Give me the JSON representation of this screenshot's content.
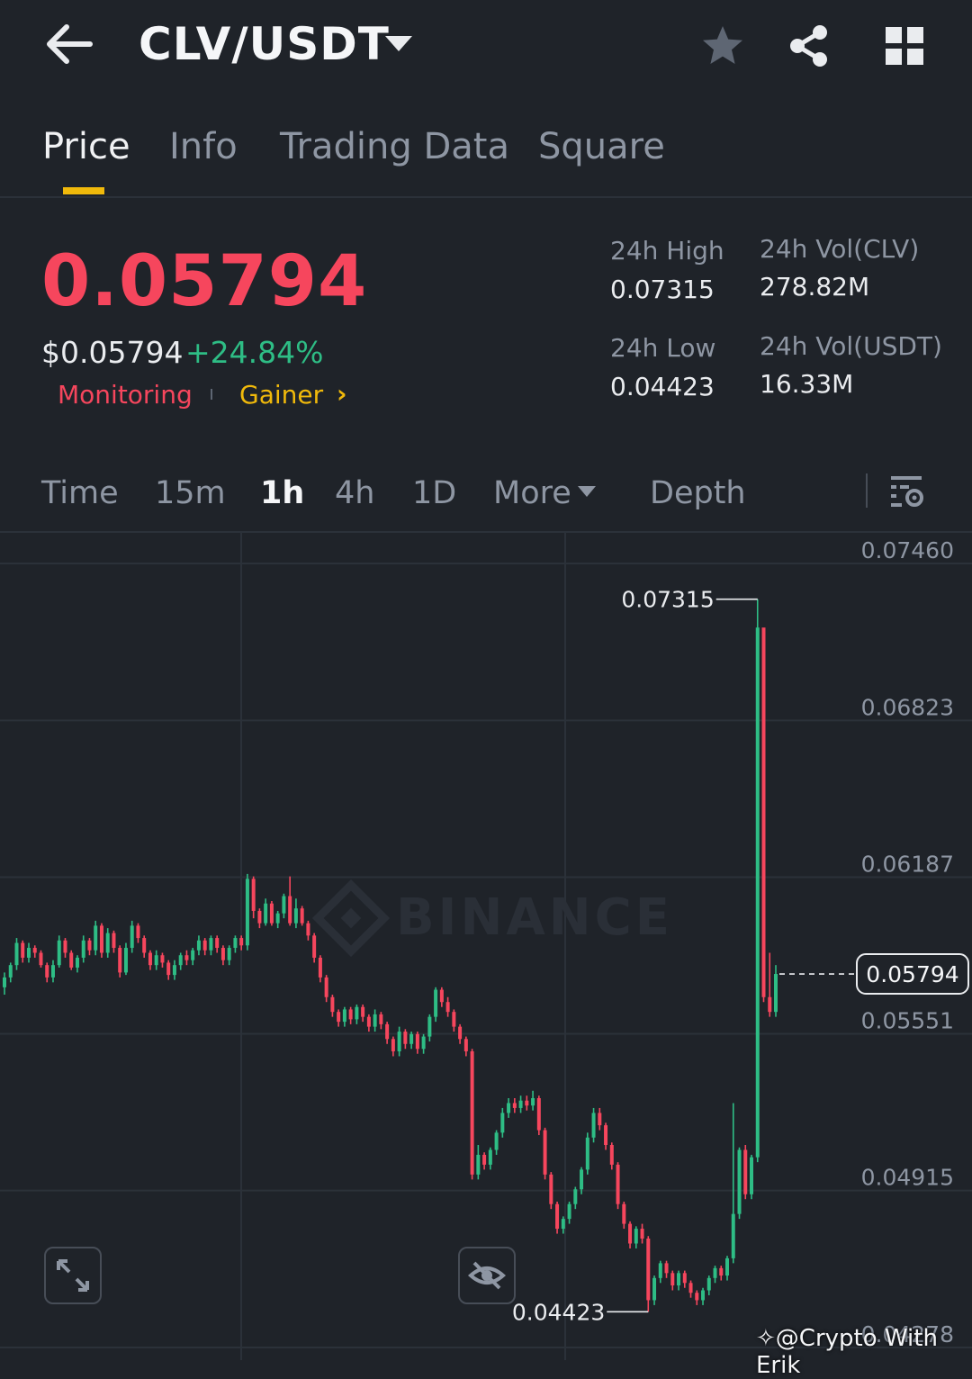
{
  "header": {
    "pair": "CLV/USDT",
    "icons": [
      "back-arrow-icon",
      "caret-down-icon",
      "star-icon",
      "share-icon",
      "grid-icon"
    ]
  },
  "tabs": [
    {
      "label": "Price",
      "active": true
    },
    {
      "label": "Info",
      "active": false
    },
    {
      "label": "Trading Data",
      "active": false
    },
    {
      "label": "Square",
      "active": false
    }
  ],
  "ticker": {
    "last_price": "0.05794",
    "fiat_price": "$0.05794",
    "change": "+24.84%",
    "tag_monitoring": "Monitoring",
    "tag_gainer": "Gainer",
    "tag_chevron": "›",
    "high_label": "24h High",
    "high_value": "0.07315",
    "low_label": "24h Low",
    "low_value": "0.04423",
    "vol_base_label": "24h Vol(CLV)",
    "vol_base_value": "278.82M",
    "vol_quote_label": "24h Vol(USDT)",
    "vol_quote_value": "16.33M"
  },
  "intervals": {
    "items": [
      {
        "label": "Time",
        "active": false
      },
      {
        "label": "15m",
        "active": false
      },
      {
        "label": "1h",
        "active": true
      },
      {
        "label": "4h",
        "active": false
      },
      {
        "label": "1D",
        "active": false
      },
      {
        "label": "More",
        "active": false
      },
      {
        "label": "Depth",
        "active": false
      }
    ]
  },
  "colors": {
    "up": "#2ebd85",
    "down": "#f6465d",
    "accent": "#f0b90b",
    "bg": "#1f2329"
  },
  "chart_data": {
    "type": "candlestick",
    "y_ticks": [
      "0.07460",
      "0.06823",
      "0.06187",
      "0.05551",
      "0.04915",
      "0.04278"
    ],
    "ylim": [
      0.04278,
      0.0746
    ],
    "high_marker": "0.07315",
    "low_marker": "0.04423",
    "last_price_label": "0.05794",
    "last_price": 0.05794,
    "watermark": "BINANCE",
    "candles": [
      [
        0.0574,
        0.0578,
        0.0571,
        0.058
      ],
      [
        0.0578,
        0.0583,
        0.0576,
        0.0584
      ],
      [
        0.0583,
        0.0592,
        0.0581,
        0.0594
      ],
      [
        0.0592,
        0.0586,
        0.0584,
        0.0593
      ],
      [
        0.0586,
        0.059,
        0.0584,
        0.0592
      ],
      [
        0.059,
        0.0588,
        0.0586,
        0.0591
      ],
      [
        0.0588,
        0.0583,
        0.0582,
        0.0589
      ],
      [
        0.0583,
        0.0578,
        0.0576,
        0.0584
      ],
      [
        0.0578,
        0.0583,
        0.0576,
        0.0585
      ],
      [
        0.0583,
        0.0593,
        0.0582,
        0.0595
      ],
      [
        0.0593,
        0.0588,
        0.0586,
        0.0594
      ],
      [
        0.0588,
        0.0582,
        0.0581,
        0.0589
      ],
      [
        0.0582,
        0.0586,
        0.058,
        0.0587
      ],
      [
        0.0586,
        0.0593,
        0.0584,
        0.0595
      ],
      [
        0.0593,
        0.0589,
        0.0587,
        0.0594
      ],
      [
        0.0589,
        0.0599,
        0.0587,
        0.0601
      ],
      [
        0.0599,
        0.0588,
        0.0586,
        0.06
      ],
      [
        0.0588,
        0.0596,
        0.0586,
        0.0598
      ],
      [
        0.0596,
        0.059,
        0.0588,
        0.0597
      ],
      [
        0.059,
        0.058,
        0.0578,
        0.0591
      ],
      [
        0.058,
        0.059,
        0.0579,
        0.0592
      ],
      [
        0.059,
        0.0599,
        0.0588,
        0.0601
      ],
      [
        0.0599,
        0.0594,
        0.0592,
        0.06
      ],
      [
        0.0594,
        0.0588,
        0.0586,
        0.0595
      ],
      [
        0.0588,
        0.0583,
        0.0581,
        0.0589
      ],
      [
        0.0583,
        0.0587,
        0.0581,
        0.0589
      ],
      [
        0.0587,
        0.0584,
        0.0582,
        0.0588
      ],
      [
        0.0584,
        0.0579,
        0.0577,
        0.0585
      ],
      [
        0.0579,
        0.0583,
        0.0577,
        0.0585
      ],
      [
        0.0583,
        0.0587,
        0.0581,
        0.0588
      ],
      [
        0.0587,
        0.0585,
        0.0583,
        0.0589
      ],
      [
        0.0585,
        0.0589,
        0.0583,
        0.059
      ],
      [
        0.0589,
        0.0593,
        0.0587,
        0.0595
      ],
      [
        0.0593,
        0.0589,
        0.0587,
        0.0594
      ],
      [
        0.0589,
        0.0594,
        0.0587,
        0.0595
      ],
      [
        0.0594,
        0.059,
        0.0588,
        0.0595
      ],
      [
        0.059,
        0.0585,
        0.0583,
        0.0591
      ],
      [
        0.0585,
        0.059,
        0.0583,
        0.0591
      ],
      [
        0.059,
        0.0594,
        0.0588,
        0.0595
      ],
      [
        0.0594,
        0.0591,
        0.0589,
        0.0595
      ],
      [
        0.0591,
        0.0618,
        0.0589,
        0.062
      ],
      [
        0.0618,
        0.0605,
        0.0602,
        0.0619
      ],
      [
        0.0605,
        0.06,
        0.0598,
        0.0606
      ],
      [
        0.06,
        0.0608,
        0.0599,
        0.061
      ],
      [
        0.0608,
        0.06,
        0.0599,
        0.0609
      ],
      [
        0.06,
        0.0604,
        0.0598,
        0.0605
      ],
      [
        0.0604,
        0.0611,
        0.0602,
        0.0612
      ],
      [
        0.0611,
        0.06,
        0.0599,
        0.0619
      ],
      [
        0.06,
        0.0606,
        0.0598,
        0.061
      ],
      [
        0.0606,
        0.06,
        0.0599,
        0.0607
      ],
      [
        0.06,
        0.0595,
        0.0593,
        0.0601
      ],
      [
        0.0595,
        0.0586,
        0.0584,
        0.0596
      ],
      [
        0.0586,
        0.0578,
        0.0576,
        0.0587
      ],
      [
        0.0578,
        0.057,
        0.0568,
        0.0579
      ],
      [
        0.057,
        0.0564,
        0.0562,
        0.0571
      ],
      [
        0.0564,
        0.056,
        0.0558,
        0.0565
      ],
      [
        0.056,
        0.0565,
        0.0558,
        0.0566
      ],
      [
        0.0565,
        0.0561,
        0.0559,
        0.0566
      ],
      [
        0.0561,
        0.0566,
        0.0559,
        0.0567
      ],
      [
        0.0566,
        0.0562,
        0.056,
        0.0567
      ],
      [
        0.0562,
        0.0558,
        0.0556,
        0.0563
      ],
      [
        0.0558,
        0.0563,
        0.0556,
        0.0565
      ],
      [
        0.0563,
        0.0559,
        0.0557,
        0.0564
      ],
      [
        0.0559,
        0.0553,
        0.0551,
        0.056
      ],
      [
        0.0553,
        0.0548,
        0.0546,
        0.0554
      ],
      [
        0.0548,
        0.0556,
        0.0546,
        0.0558
      ],
      [
        0.0556,
        0.0551,
        0.0549,
        0.0557
      ],
      [
        0.0551,
        0.0555,
        0.0549,
        0.0556
      ],
      [
        0.0555,
        0.0549,
        0.0547,
        0.0556
      ],
      [
        0.0549,
        0.0554,
        0.0547,
        0.0555
      ],
      [
        0.0554,
        0.0562,
        0.0552,
        0.0563
      ],
      [
        0.0562,
        0.0573,
        0.056,
        0.0574
      ],
      [
        0.0573,
        0.0568,
        0.0566,
        0.0574
      ],
      [
        0.0568,
        0.0564,
        0.0562,
        0.057
      ],
      [
        0.0564,
        0.0558,
        0.0556,
        0.0565
      ],
      [
        0.0558,
        0.0553,
        0.0551,
        0.0559
      ],
      [
        0.0553,
        0.0548,
        0.0546,
        0.0554
      ],
      [
        0.0548,
        0.0498,
        0.0496,
        0.0549
      ],
      [
        0.0498,
        0.0506,
        0.0496,
        0.051
      ],
      [
        0.0506,
        0.0502,
        0.05,
        0.0507
      ],
      [
        0.0502,
        0.0508,
        0.05,
        0.0509
      ],
      [
        0.0508,
        0.0515,
        0.0506,
        0.0516
      ],
      [
        0.0515,
        0.0523,
        0.0513,
        0.0525
      ],
      [
        0.0523,
        0.0527,
        0.0521,
        0.0529
      ],
      [
        0.0527,
        0.0525,
        0.0523,
        0.0529
      ],
      [
        0.0525,
        0.0528,
        0.0523,
        0.053
      ],
      [
        0.0528,
        0.0526,
        0.0524,
        0.053
      ],
      [
        0.0526,
        0.0529,
        0.0524,
        0.0532
      ],
      [
        0.0529,
        0.0516,
        0.0514,
        0.053
      ],
      [
        0.0516,
        0.0498,
        0.0496,
        0.0517
      ],
      [
        0.0498,
        0.0486,
        0.0484,
        0.0499
      ],
      [
        0.0486,
        0.0476,
        0.0474,
        0.0487
      ],
      [
        0.0476,
        0.048,
        0.0474,
        0.0481
      ],
      [
        0.048,
        0.0486,
        0.0478,
        0.0487
      ],
      [
        0.0486,
        0.0492,
        0.0484,
        0.0493
      ],
      [
        0.0492,
        0.05,
        0.049,
        0.0501
      ],
      [
        0.05,
        0.0513,
        0.0498,
        0.0515
      ],
      [
        0.0513,
        0.0523,
        0.0511,
        0.0525
      ],
      [
        0.0523,
        0.0518,
        0.0516,
        0.0525
      ],
      [
        0.0518,
        0.051,
        0.0508,
        0.0519
      ],
      [
        0.051,
        0.0502,
        0.05,
        0.0511
      ],
      [
        0.0502,
        0.0486,
        0.0484,
        0.0503
      ],
      [
        0.0486,
        0.0478,
        0.0476,
        0.0487
      ],
      [
        0.0478,
        0.047,
        0.0468,
        0.0479
      ],
      [
        0.047,
        0.0476,
        0.0468,
        0.0477
      ],
      [
        0.0476,
        0.0472,
        0.047,
        0.0478
      ],
      [
        0.0472,
        0.0447,
        0.04423,
        0.0473
      ],
      [
        0.0447,
        0.0456,
        0.0445,
        0.0457
      ],
      [
        0.0456,
        0.0462,
        0.0454,
        0.0463
      ],
      [
        0.0462,
        0.0458,
        0.0456,
        0.0463
      ],
      [
        0.0458,
        0.0453,
        0.0451,
        0.0459
      ],
      [
        0.0453,
        0.0458,
        0.0451,
        0.0459
      ],
      [
        0.0458,
        0.0454,
        0.0452,
        0.0459
      ],
      [
        0.0454,
        0.045,
        0.0448,
        0.0455
      ],
      [
        0.045,
        0.0447,
        0.0445,
        0.0451
      ],
      [
        0.0447,
        0.0451,
        0.0445,
        0.0452
      ],
      [
        0.0451,
        0.0456,
        0.0449,
        0.0457
      ],
      [
        0.0456,
        0.046,
        0.0454,
        0.0461
      ],
      [
        0.046,
        0.0457,
        0.0455,
        0.0461
      ],
      [
        0.0457,
        0.0464,
        0.0455,
        0.0465
      ],
      [
        0.0464,
        0.0482,
        0.0462,
        0.0527
      ],
      [
        0.0482,
        0.0508,
        0.048,
        0.0509
      ],
      [
        0.0508,
        0.049,
        0.0488,
        0.051
      ],
      [
        0.049,
        0.0505,
        0.0488,
        0.0506
      ],
      [
        0.0505,
        0.072,
        0.0503,
        0.07315
      ],
      [
        0.072,
        0.057,
        0.0568,
        0.0695
      ],
      [
        0.057,
        0.0564,
        0.0562,
        0.0588
      ],
      [
        0.0564,
        0.05794,
        0.0562,
        0.0583
      ]
    ]
  },
  "footer": {
    "watermark": "@Crypto With Erik"
  }
}
